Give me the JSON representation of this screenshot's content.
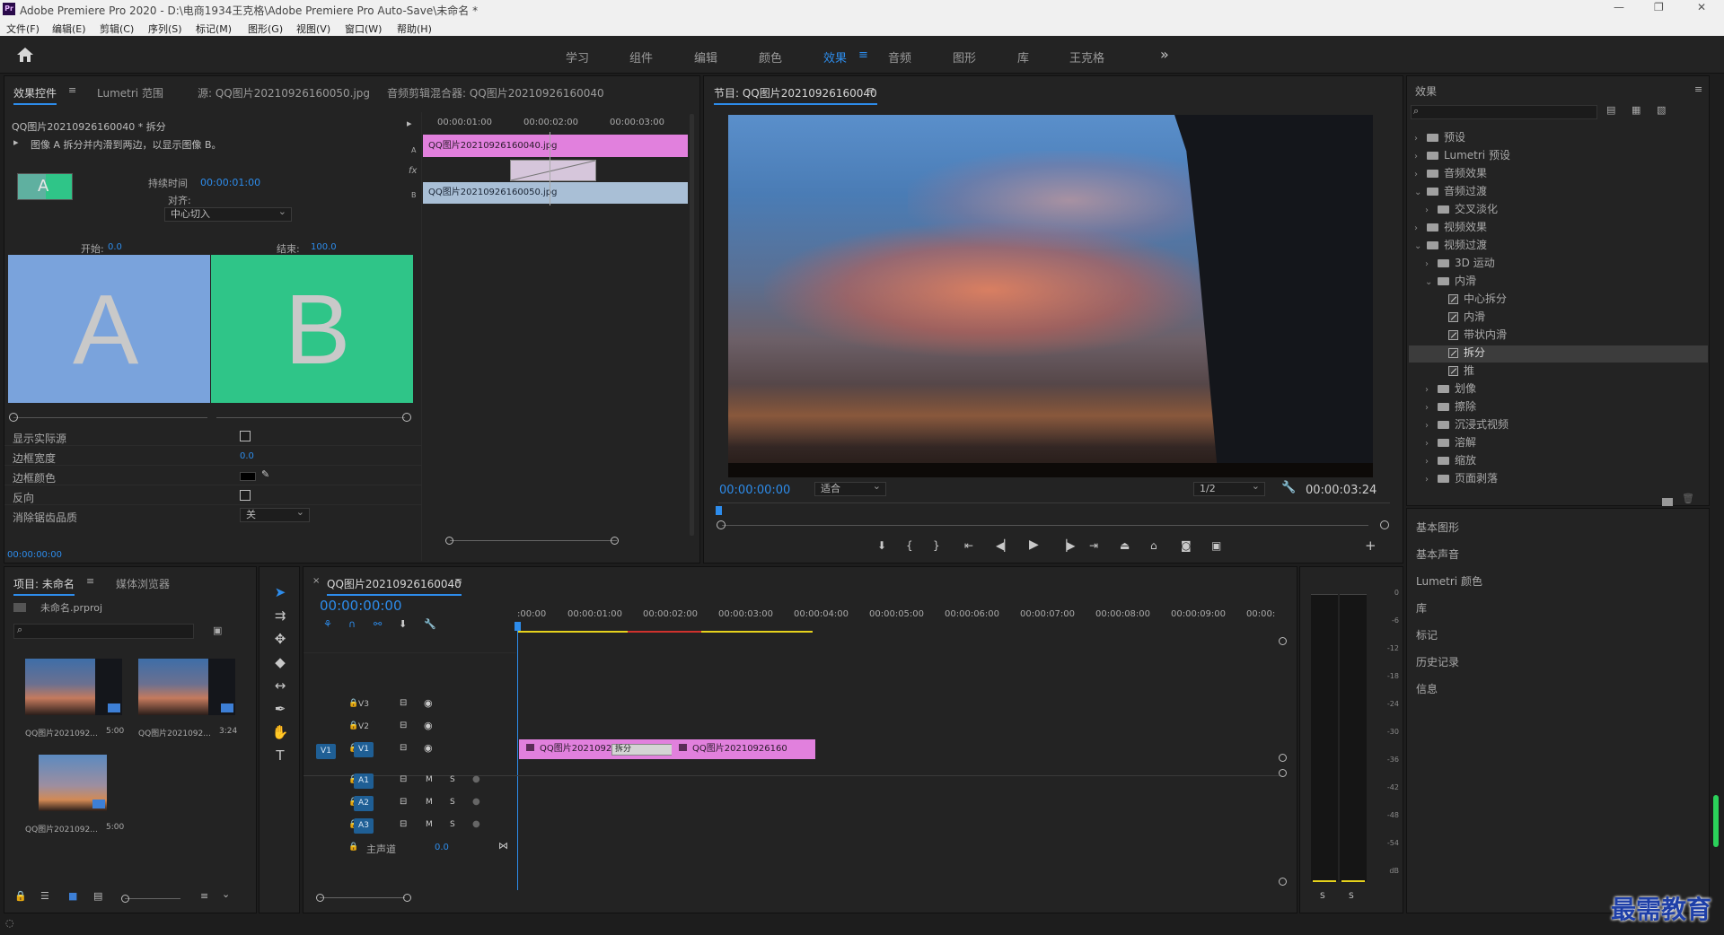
{
  "window": {
    "title": "Adobe Premiere Pro 2020 - D:\\电商1934王克格\\Adobe Premiere Pro Auto-Save\\未命名 *",
    "controls": [
      "—",
      "❐",
      "✕"
    ]
  },
  "menu": [
    "文件(F)",
    "编辑(E)",
    "剪辑(C)",
    "序列(S)",
    "标记(M)",
    "图形(G)",
    "视图(V)",
    "窗口(W)",
    "帮助(H)"
  ],
  "workspaces": [
    "学习",
    "组件",
    "编辑",
    "颜色",
    "效果",
    "音频",
    "图形",
    "库",
    "王克格"
  ],
  "workspace_more": "»",
  "effect_controls": {
    "tabs": [
      "效果控件",
      "Lumetri 范围",
      "源: QQ图片20210926160050.jpg",
      "音频剪辑混合器: QQ图片20210926160040"
    ],
    "clip_title": "QQ图片20210926160040 * 拆分",
    "description": "图像 A 拆分并内滑到两边，以显示图像 B。",
    "duration_label": "持续时间",
    "duration_value": "00:00:01:00",
    "align_label": "对齐:",
    "align_value": "中心切入",
    "start_label": "开始:",
    "start_value": "0.0",
    "end_label": "结束:",
    "end_value": "100.0",
    "thumb_a": "A",
    "thumb_b": "B",
    "props": [
      {
        "label": "显示实际源"
      },
      {
        "label": "边框宽度",
        "value": "0.0"
      },
      {
        "label": "边框颜色"
      },
      {
        "label": "反向"
      },
      {
        "label": "消除锯齿品质",
        "value": "关"
      }
    ],
    "timecode": "00:00:00:00",
    "ruler": [
      "00:00:01:00",
      "00:00:02:00",
      "00:00:03:00"
    ],
    "clip_a": "QQ图片20210926160040.jpg",
    "clip_b": "QQ图片20210926160050.jpg",
    "track_a": "A",
    "track_b": "B",
    "fx": "fx"
  },
  "program": {
    "title": "节目: QQ图片20210926160040",
    "timecode": "00:00:00:00",
    "fit": "适合",
    "resolution": "1/2",
    "duration": "00:00:03:24"
  },
  "effects_panel": {
    "title": "效果",
    "tree": [
      {
        "label": "预设",
        "level": 0,
        "kind": "folder",
        "chev": "›"
      },
      {
        "label": "Lumetri 预设",
        "level": 0,
        "kind": "folder",
        "chev": "›"
      },
      {
        "label": "音频效果",
        "level": 0,
        "kind": "folder",
        "chev": "›"
      },
      {
        "label": "音频过渡",
        "level": 0,
        "kind": "folder",
        "chev": "⌄"
      },
      {
        "label": "交叉淡化",
        "level": 1,
        "kind": "folder",
        "chev": "›"
      },
      {
        "label": "视频效果",
        "level": 0,
        "kind": "folder",
        "chev": "›"
      },
      {
        "label": "视频过渡",
        "level": 0,
        "kind": "folder",
        "chev": "⌄"
      },
      {
        "label": "3D 运动",
        "level": 1,
        "kind": "folder",
        "chev": "›"
      },
      {
        "label": "内滑",
        "level": 1,
        "kind": "folder",
        "chev": "⌄"
      },
      {
        "label": "中心拆分",
        "level": 2,
        "kind": "fx"
      },
      {
        "label": "内滑",
        "level": 2,
        "kind": "fx"
      },
      {
        "label": "带状内滑",
        "level": 2,
        "kind": "fx"
      },
      {
        "label": "拆分",
        "level": 2,
        "kind": "fx",
        "selected": true
      },
      {
        "label": "推",
        "level": 2,
        "kind": "fx"
      },
      {
        "label": "划像",
        "level": 1,
        "kind": "folder",
        "chev": "›"
      },
      {
        "label": "擦除",
        "level": 1,
        "kind": "folder",
        "chev": "›"
      },
      {
        "label": "沉浸式视频",
        "level": 1,
        "kind": "folder",
        "chev": "›"
      },
      {
        "label": "溶解",
        "level": 1,
        "kind": "folder",
        "chev": "›"
      },
      {
        "label": "缩放",
        "level": 1,
        "kind": "folder",
        "chev": "›"
      },
      {
        "label": "页面剥落",
        "level": 1,
        "kind": "folder",
        "chev": "›"
      }
    ],
    "sections": [
      "基本图形",
      "基本声音",
      "Lumetri 颜色",
      "库",
      "标记",
      "历史记录",
      "信息"
    ]
  },
  "project": {
    "tabs": [
      "项目: 未命名",
      "媒体浏览器"
    ],
    "file": "未命名.prproj",
    "items": [
      {
        "name": "QQ图片2021092...",
        "dur": "5:00"
      },
      {
        "name": "QQ图片2021092...",
        "dur": "3:24"
      },
      {
        "name": "QQ图片2021092...",
        "dur": "5:00"
      }
    ]
  },
  "timeline": {
    "tab": "QQ图片20210926160040",
    "timecode": "00:00:00:00",
    "ruler": [
      ":00:00",
      "00:00:01:00",
      "00:00:02:00",
      "00:00:03:00",
      "00:00:04:00",
      "00:00:05:00",
      "00:00:06:00",
      "00:00:07:00",
      "00:00:08:00",
      "00:00:09:00",
      "00:00:"
    ],
    "video_tracks": [
      "V3",
      "V2",
      "V1"
    ],
    "audio_tracks": [
      "A1",
      "A2",
      "A3"
    ],
    "source_v": "V1",
    "m": "M",
    "s": "S",
    "master": "主声道",
    "master_value": "0.0",
    "clip1": "QQ图片20210926160",
    "transition": "拆分",
    "clip2": "QQ图片20210926160"
  },
  "meter": {
    "scale": [
      "0",
      "-6",
      "-12",
      "-18",
      "-24",
      "-30",
      "-36",
      "-42",
      "-48",
      "-54",
      "dB"
    ],
    "solo": [
      "S",
      "S"
    ]
  },
  "watermark": "最需教育",
  "colors": {
    "accent": "#2d8ceb",
    "clip": "#e180dd",
    "clip_b": "#a9bfd6",
    "thumb_a": "#7aa3dc",
    "thumb_b": "#2fc588"
  }
}
